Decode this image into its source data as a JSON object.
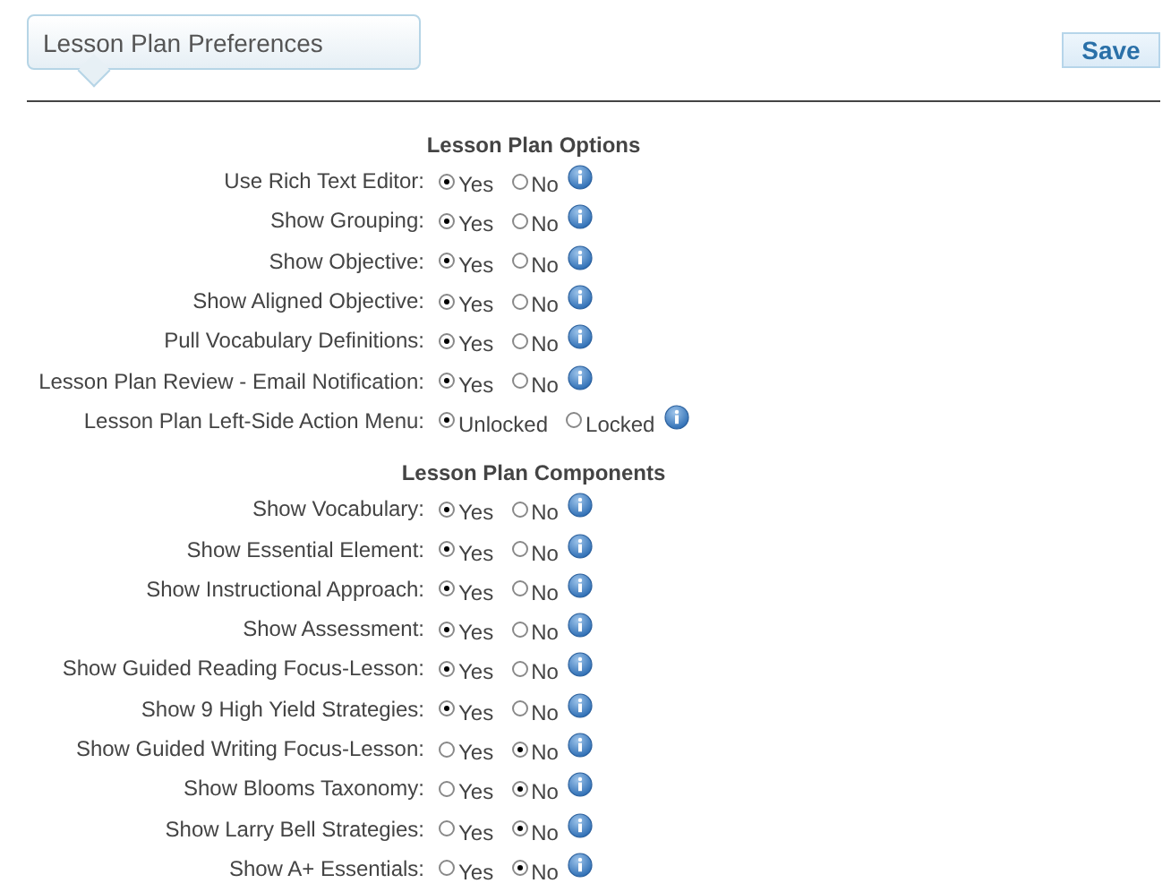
{
  "header": {
    "title": "Lesson Plan Preferences",
    "save_button": "Save"
  },
  "sections": [
    {
      "title": "Lesson Plan Options",
      "rows": [
        {
          "label": "Use Rich Text Editor:",
          "options": [
            {
              "label": "Yes",
              "selected": true
            },
            {
              "label": "No",
              "selected": false
            }
          ]
        },
        {
          "label": "Show Grouping:",
          "options": [
            {
              "label": "Yes",
              "selected": true
            },
            {
              "label": "No",
              "selected": false
            }
          ]
        },
        {
          "label": "Show Objective:",
          "options": [
            {
              "label": "Yes",
              "selected": true
            },
            {
              "label": "No",
              "selected": false
            }
          ]
        },
        {
          "label": "Show Aligned Objective:",
          "options": [
            {
              "label": "Yes",
              "selected": true
            },
            {
              "label": "No",
              "selected": false
            }
          ]
        },
        {
          "label": "Pull Vocabulary Definitions:",
          "options": [
            {
              "label": "Yes",
              "selected": true
            },
            {
              "label": "No",
              "selected": false
            }
          ]
        },
        {
          "label": "Lesson Plan Review - Email Notification:",
          "options": [
            {
              "label": "Yes",
              "selected": true
            },
            {
              "label": "No",
              "selected": false
            }
          ]
        },
        {
          "label": "Lesson Plan Left-Side Action Menu:",
          "options": [
            {
              "label": "Unlocked",
              "selected": true
            },
            {
              "label": "Locked",
              "selected": false
            }
          ]
        }
      ]
    },
    {
      "title": "Lesson Plan Components",
      "rows": [
        {
          "label": "Show Vocabulary:",
          "options": [
            {
              "label": "Yes",
              "selected": true
            },
            {
              "label": "No",
              "selected": false
            }
          ]
        },
        {
          "label": "Show Essential Element:",
          "options": [
            {
              "label": "Yes",
              "selected": true
            },
            {
              "label": "No",
              "selected": false
            }
          ]
        },
        {
          "label": "Show Instructional Approach:",
          "options": [
            {
              "label": "Yes",
              "selected": true
            },
            {
              "label": "No",
              "selected": false
            }
          ]
        },
        {
          "label": "Show Assessment:",
          "options": [
            {
              "label": "Yes",
              "selected": true
            },
            {
              "label": "No",
              "selected": false
            }
          ]
        },
        {
          "label": "Show Guided Reading Focus-Lesson:",
          "options": [
            {
              "label": "Yes",
              "selected": true
            },
            {
              "label": "No",
              "selected": false
            }
          ]
        },
        {
          "label": "Show 9 High Yield Strategies:",
          "options": [
            {
              "label": "Yes",
              "selected": true
            },
            {
              "label": "No",
              "selected": false
            }
          ]
        },
        {
          "label": "Show Guided Writing Focus-Lesson:",
          "options": [
            {
              "label": "Yes",
              "selected": false
            },
            {
              "label": "No",
              "selected": true
            }
          ]
        },
        {
          "label": "Show Blooms Taxonomy:",
          "options": [
            {
              "label": "Yes",
              "selected": false
            },
            {
              "label": "No",
              "selected": true
            }
          ]
        },
        {
          "label": "Show Larry Bell Strategies:",
          "options": [
            {
              "label": "Yes",
              "selected": false
            },
            {
              "label": "No",
              "selected": true
            }
          ]
        },
        {
          "label": "Show A+ Essentials:",
          "options": [
            {
              "label": "Yes",
              "selected": false
            },
            {
              "label": "No",
              "selected": true
            }
          ]
        }
      ]
    }
  ]
}
